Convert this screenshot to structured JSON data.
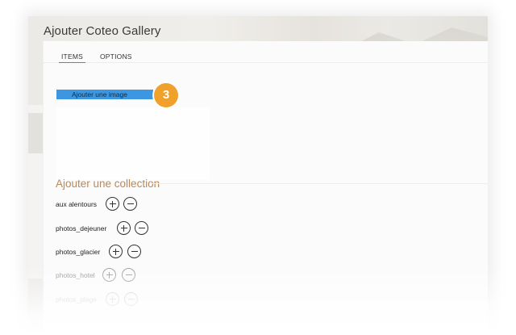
{
  "window": {
    "title": "Ajouter Coteo Gallery"
  },
  "tabs": [
    {
      "label": "ITEMS",
      "active": true
    },
    {
      "label": "OPTIONS",
      "active": false
    }
  ],
  "items": {
    "add_image_label": "Ajouter une image",
    "step_number": "3"
  },
  "collection": {
    "title": "Ajouter une collection",
    "rows": [
      {
        "name": "aux alentours"
      },
      {
        "name": "photos_dejeuner"
      },
      {
        "name": "photos_glacier"
      },
      {
        "name": "photos_hotel"
      },
      {
        "name": "photos_plage"
      }
    ]
  },
  "icons": {
    "add": "plus-circle-icon",
    "remove": "minus-circle-icon"
  },
  "colors": {
    "accent_blue": "#3d96e0",
    "badge_orange": "#f0a12c",
    "collection_title": "#b8895a"
  }
}
